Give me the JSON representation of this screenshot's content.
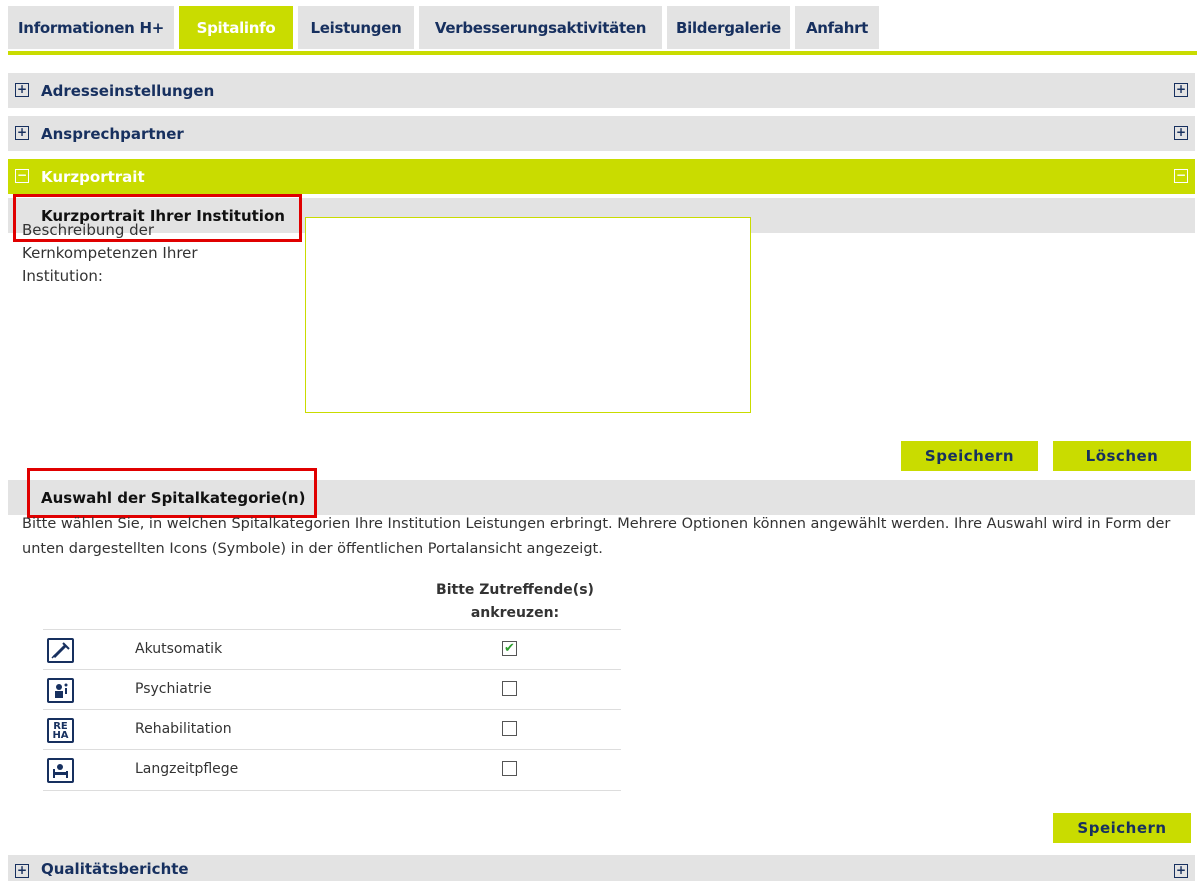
{
  "tabs": [
    {
      "label": "Informationen H+",
      "active": false
    },
    {
      "label": "Spitalinfo",
      "active": true
    },
    {
      "label": "Leistungen",
      "active": false
    },
    {
      "label": "Verbesserungsaktivitäten",
      "active": false
    },
    {
      "label": "Bildergalerie",
      "active": false
    },
    {
      "label": "Anfahrt",
      "active": false
    }
  ],
  "sections": {
    "adresse": {
      "label": "Adresseinstellungen",
      "toggle": "+"
    },
    "ansprech": {
      "label": "Ansprechpartner",
      "toggle": "+"
    },
    "kurzportrait": {
      "label": "Kurzportrait",
      "toggle": "−"
    },
    "qualitaet": {
      "label": "Qualitätsberichte",
      "toggle": "+"
    }
  },
  "kurzportrait": {
    "heading": "Kurzportrait Ihrer Institution",
    "field_label": "Beschreibung der Kernkompetenzen Ihrer Institution:",
    "value": "",
    "save_label": "Speichern",
    "delete_label": "Löschen"
  },
  "kategorie": {
    "heading": "Auswahl der Spitalkategorie(n)",
    "description": "Bitte wählen Sie, in welchen Spitalkategorien Ihre Institution Leistungen erbringt. Mehrere Optionen können angewählt werden. Ihre Auswahl wird in Form der unten dargestellten Icons (Symbole) in der öffentlichen Portalansicht angezeigt.",
    "column_header": "Bitte Zutreffende(s) ankreuzen:",
    "rows": [
      {
        "label": "Akutsomatik",
        "icon": "syringe-icon",
        "checked": true
      },
      {
        "label": "Psychiatrie",
        "icon": "psychiatry-icon",
        "checked": false
      },
      {
        "label": "Rehabilitation",
        "icon": "reha-icon",
        "icon_text": "RE HA",
        "checked": false
      },
      {
        "label": "Langzeitpflege",
        "icon": "bed-icon",
        "checked": false
      }
    ],
    "save_label": "Speichern"
  },
  "colors": {
    "accent": "#c9dc00",
    "navy": "#17305f",
    "gray": "#e3e3e3",
    "highlight": "#e00000"
  }
}
